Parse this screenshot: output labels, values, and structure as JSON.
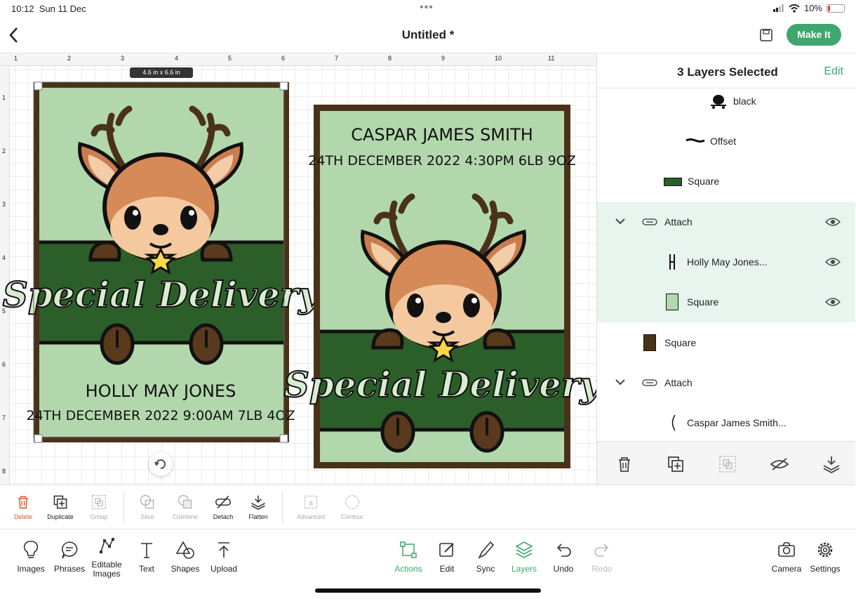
{
  "status": {
    "time": "10:12",
    "date": "Sun 11 Dec",
    "battery": "10%"
  },
  "header": {
    "title": "Untitled *",
    "make_it": "Make It"
  },
  "rulers": {
    "top": [
      "1",
      "2",
      "3",
      "4",
      "5",
      "6",
      "7",
      "8",
      "9",
      "10",
      "11"
    ],
    "left": [
      "1",
      "2",
      "3",
      "4",
      "5",
      "6",
      "7",
      "8"
    ]
  },
  "canvas": {
    "size_tag": "4.6 in x 6.6 in",
    "card1": {
      "banner": "Special Delivery",
      "name": "HOLLY MAY JONES",
      "detail": "24TH DECEMBER 2022  9:00AM  7LB 4OZ"
    },
    "card2": {
      "name": "CASPAR JAMES SMITH",
      "detail": "24TH DECEMBER 2022  4:30PM  6LB 9OZ",
      "banner": "Special Delivery"
    }
  },
  "colors": {
    "accent": "#3fa66d",
    "light_green": "#b2d7ac",
    "dark_green": "#2c5e2a",
    "brown": "#4a3218"
  },
  "layers": {
    "title": "3 Layers Selected",
    "edit": "Edit",
    "items": [
      {
        "label": "black",
        "icon": "black-layer-icon"
      },
      {
        "label": "Offset",
        "icon": "offset-icon"
      },
      {
        "label": "Square",
        "icon": "dark-green-square-icon"
      },
      {
        "label": "Attach",
        "icon": "attach-icon"
      },
      {
        "label": "Holly May Jones...",
        "icon": "text-layer-icon"
      },
      {
        "label": "Square",
        "icon": "light-green-square-icon"
      },
      {
        "label": "Square",
        "icon": "brown-square-icon"
      },
      {
        "label": "Attach",
        "icon": "attach-icon"
      },
      {
        "label": "Caspar James Smith...",
        "icon": "text-layer-icon"
      }
    ]
  },
  "edit_toolbar": {
    "delete": "Delete",
    "duplicate": "Duplicate",
    "group": "Group",
    "slice": "Slice",
    "combine": "Combine",
    "detach": "Detach",
    "flatten": "Flatten",
    "advanced": "Advanced",
    "contour": "Contour"
  },
  "bottom_toolbar": {
    "images": "Images",
    "phrases": "Phrases",
    "editable_images": "Editable Images",
    "text": "Text",
    "shapes": "Shapes",
    "upload": "Upload",
    "actions": "Actions",
    "edit": "Edit",
    "sync": "Sync",
    "layers": "Layers",
    "undo": "Undo",
    "redo": "Redo",
    "camera": "Camera",
    "settings": "Settings"
  }
}
